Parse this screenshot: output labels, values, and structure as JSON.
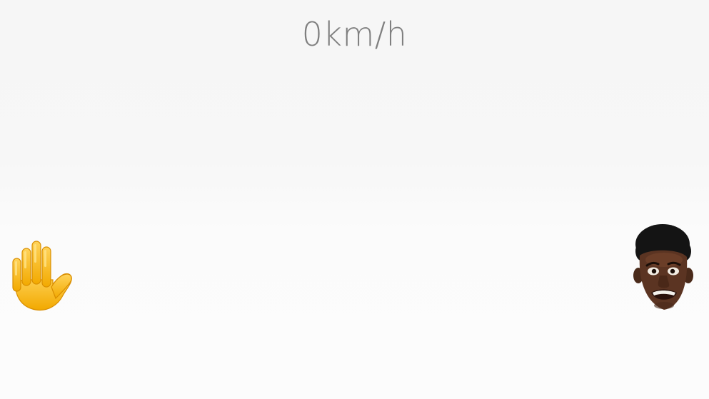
{
  "hud": {
    "speed_value": 0,
    "speed_unit": "km/h",
    "speed_text": "0km/h"
  },
  "player": {
    "icon": "raised-hand-icon",
    "color": "#FFC83D"
  },
  "chaser": {
    "icon": "face-head-icon"
  },
  "colors": {
    "background": "#F7F7F7",
    "speed_text": "#7F7F7F"
  }
}
